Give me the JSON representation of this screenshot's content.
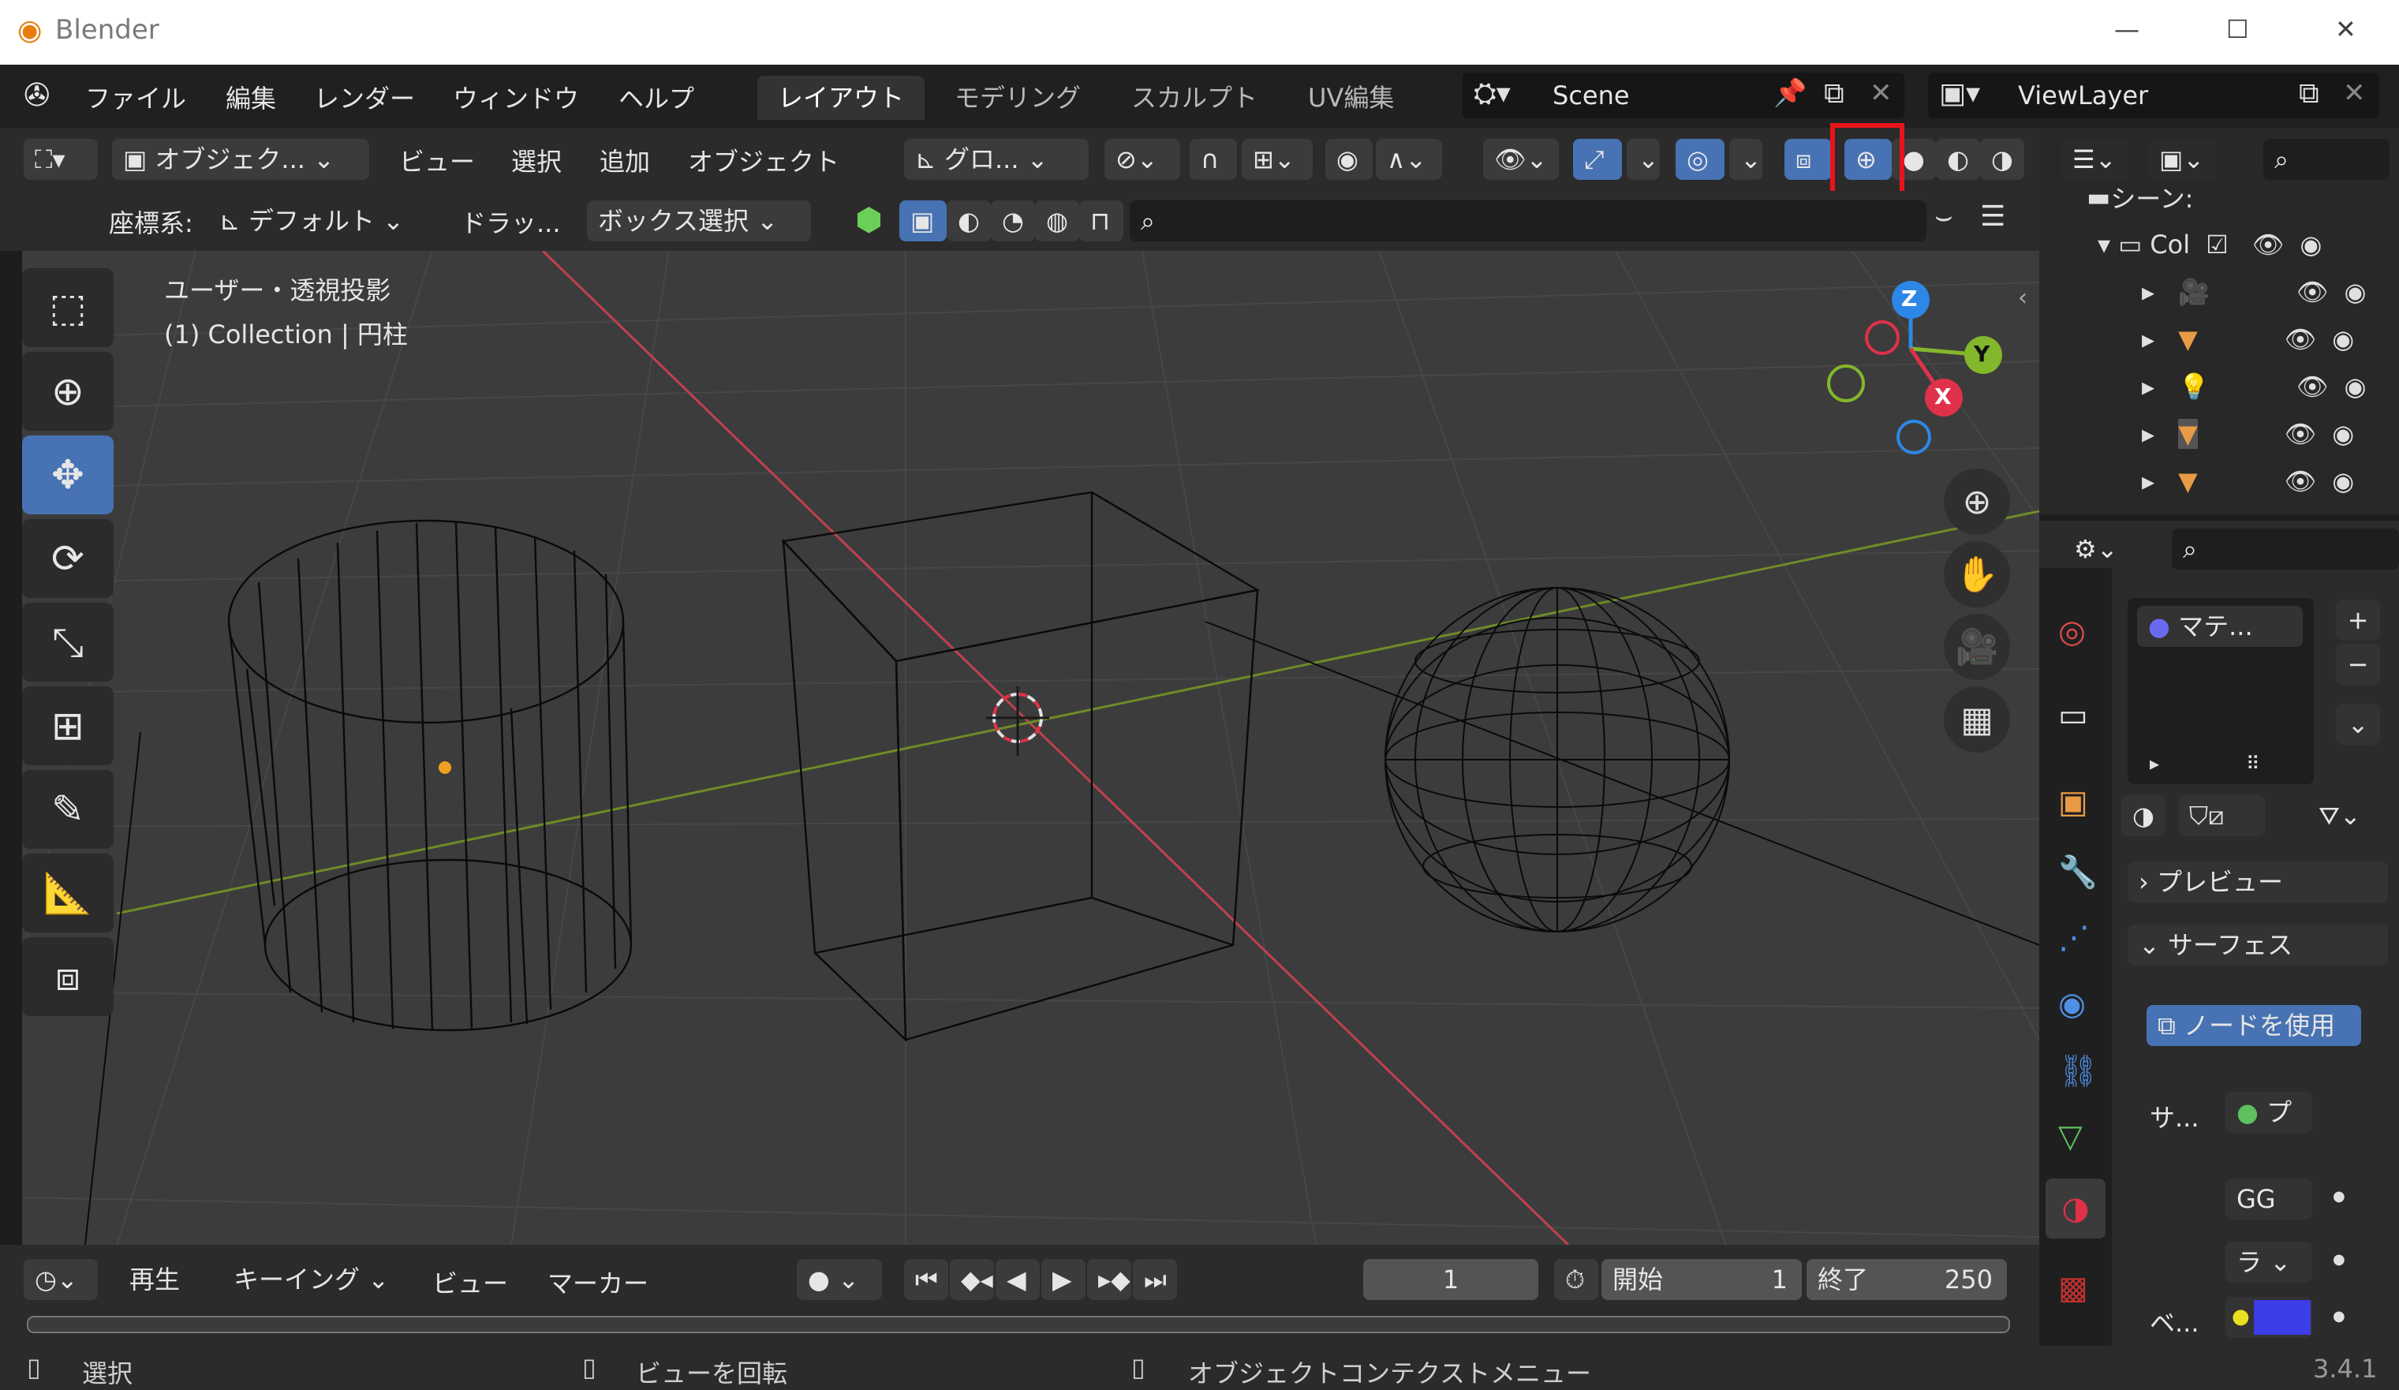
{
  "window": {
    "app_title": "Blender",
    "minimize": "—",
    "maximize": "☐",
    "close": "✕"
  },
  "menu": {
    "items": [
      "ファイル",
      "編集",
      "レンダー",
      "ウィンドウ",
      "ヘルプ"
    ],
    "workspaces": [
      "レイアウト",
      "モデリング",
      "スカルプト",
      "UV編集"
    ],
    "active_workspace": "レイアウト",
    "scene_name": "Scene",
    "view_layer": "ViewLayer"
  },
  "viewport_header": {
    "mode": "オブジェク...",
    "view": "ビュー",
    "select": "選択",
    "add": "追加",
    "object": "オブジェクト",
    "transform_orientation": "グロ...",
    "coordinate_label": "座標系:",
    "coordinate_value": "デフォルト",
    "drag_label": "ドラッ...",
    "drag_value": "ボックス選択"
  },
  "viewport": {
    "view_name": "ユーザー・透視投影",
    "collection_info": "(1) Collection | 円柱",
    "axes": {
      "z": "Z",
      "y": "Y",
      "x": "X"
    },
    "colors": {
      "x_axis": "#e0314a",
      "y_axis": "#83b72c",
      "z_axis": "#2d87e6",
      "highlight": "#e8141b",
      "selected_tool": "#4772b3"
    }
  },
  "outliner": {
    "scene_label": "シーン:",
    "collection_label": "Col"
  },
  "properties": {
    "material_slot": "マテ...",
    "preview_panel": "プレビュー",
    "surface_panel": "サーフェス",
    "use_nodes_button": "ノードを使用",
    "surface_label": "サ...",
    "surface_value": "プ",
    "gg_value": "GG",
    "ra_value": "ラ",
    "base_label": "ベ...",
    "base_color": "#3b3de6"
  },
  "timeline": {
    "playback": "再生",
    "keying": "キーイング",
    "view": "ビュー",
    "marker": "マーカー",
    "current_frame": "1",
    "start_label": "開始",
    "start_value": "1",
    "end_label": "終了",
    "end_value": "250"
  },
  "status": {
    "select": "選択",
    "rotate_view": "ビューを回転",
    "context_menu": "オブジェクトコンテクストメニュー",
    "version": "3.4.1"
  }
}
